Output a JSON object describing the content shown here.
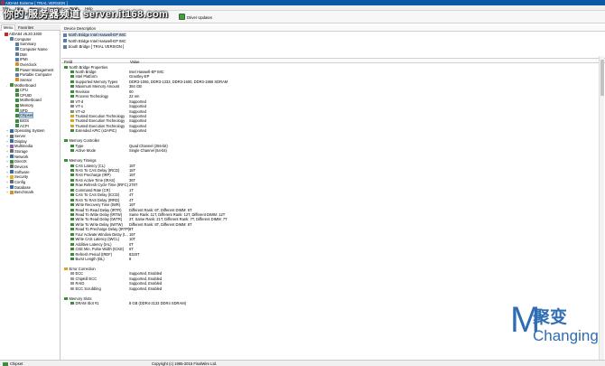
{
  "window": {
    "title": "AIDA64 Extreme [ TRIAL VERSION ]"
  },
  "watermark": "你的·服务器频道 server.it168.com",
  "menu": [
    "File",
    "View",
    "Report",
    "Favorites",
    "Tools",
    "Help"
  ],
  "toolbar": {
    "driver_updates": "Driver Updates"
  },
  "left_tabs": {
    "menu": "Menu",
    "favorites": "Favorites"
  },
  "tree": [
    {
      "label": "AIDA64 v5.20.3400",
      "level": 0,
      "exp": "",
      "color": "#c62828"
    },
    {
      "label": "Computer",
      "level": 1,
      "exp": "-",
      "color": "#5a7fa6"
    },
    {
      "label": "Summary",
      "level": 2,
      "exp": "",
      "color": "#5a7fa6"
    },
    {
      "label": "Computer Name",
      "level": 2,
      "exp": "",
      "color": "#5a7fa6"
    },
    {
      "label": "DMI",
      "level": 2,
      "exp": "",
      "color": "#5a7fa6"
    },
    {
      "label": "IPMI",
      "level": 2,
      "exp": "",
      "color": "#5a7fa6"
    },
    {
      "label": "Overclock",
      "level": 2,
      "exp": "",
      "color": "#e08a1f"
    },
    {
      "label": "Power Management",
      "level": 2,
      "exp": "",
      "color": "#5aa04c"
    },
    {
      "label": "Portable Computer",
      "level": 2,
      "exp": "",
      "color": "#5a7fa6"
    },
    {
      "label": "Sensor",
      "level": 2,
      "exp": "",
      "color": "#e08a1f"
    },
    {
      "label": "Motherboard",
      "level": 1,
      "exp": "-",
      "color": "#3a8f3a"
    },
    {
      "label": "CPU",
      "level": 2,
      "exp": "",
      "color": "#3a8f3a"
    },
    {
      "label": "CPUID",
      "level": 2,
      "exp": "",
      "color": "#3a8f3a"
    },
    {
      "label": "Motherboard",
      "level": 2,
      "exp": "",
      "color": "#3a8f3a"
    },
    {
      "label": "Memory",
      "level": 2,
      "exp": "",
      "color": "#3a8f3a"
    },
    {
      "label": "SPD",
      "level": 2,
      "exp": "",
      "color": "#3a8f3a"
    },
    {
      "label": "Chipset",
      "level": 2,
      "exp": "",
      "color": "#3a8f3a",
      "selected": true
    },
    {
      "label": "BIOS",
      "level": 2,
      "exp": "",
      "color": "#3a8f3a"
    },
    {
      "label": "ACPI",
      "level": 2,
      "exp": "",
      "color": "#3a8f3a"
    },
    {
      "label": "Operating System",
      "level": 1,
      "exp": "+",
      "color": "#2f6db3"
    },
    {
      "label": "Server",
      "level": 1,
      "exp": "+",
      "color": "#6b6b6b"
    },
    {
      "label": "Display",
      "level": 1,
      "exp": "+",
      "color": "#2f6db3"
    },
    {
      "label": "Multimedia",
      "level": 1,
      "exp": "+",
      "color": "#8a5db5"
    },
    {
      "label": "Storage",
      "level": 1,
      "exp": "+",
      "color": "#6b6b6b"
    },
    {
      "label": "Network",
      "level": 1,
      "exp": "+",
      "color": "#2f6db3"
    },
    {
      "label": "DirectX",
      "level": 1,
      "exp": "+",
      "color": "#3a8f3a"
    },
    {
      "label": "Devices",
      "level": 1,
      "exp": "+",
      "color": "#6b6b6b"
    },
    {
      "label": "Software",
      "level": 1,
      "exp": "+",
      "color": "#2f6db3"
    },
    {
      "label": "Security",
      "level": 1,
      "exp": "+",
      "color": "#e0b01f"
    },
    {
      "label": "Config",
      "level": 1,
      "exp": "+",
      "color": "#6b6b6b"
    },
    {
      "label": "Database",
      "level": 1,
      "exp": "+",
      "color": "#2f6db3"
    },
    {
      "label": "Benchmark",
      "level": 1,
      "exp": "+",
      "color": "#e08a1f"
    }
  ],
  "device_header": "Device Description",
  "devices": [
    {
      "label": "North Bridge Intel Haswell-EP IMC",
      "selected": true
    },
    {
      "label": "North Bridge Intel Haswell-EP IMC",
      "selected": false
    },
    {
      "label": "South Bridge [ TRIAL VERSION ]",
      "selected": false
    }
  ],
  "grid_header": {
    "field": "Field",
    "value": "Value"
  },
  "rows": [
    {
      "type": "section",
      "field": "North Bridge Properties",
      "value": "",
      "color": "#3a8f3a"
    },
    {
      "type": "item",
      "field": "North Bridge",
      "value": "Intel Haswell-EP IMC",
      "color": "#3a8f3a"
    },
    {
      "type": "item",
      "field": "Intel Platform",
      "value": "Grantley-EP",
      "color": "#3a8f3a"
    },
    {
      "type": "item",
      "field": "Supported Memory Types",
      "value": "DDR3-1066, DDR3-1333, DDR3-1600, DDR3-1866 SDRAM",
      "color": "#3a8f3a"
    },
    {
      "type": "item",
      "field": "Maximum Memory Amount",
      "value": "384 GB",
      "color": "#3a8f3a"
    },
    {
      "type": "item",
      "field": "Revision",
      "value": "00",
      "color": "#3a8f3a"
    },
    {
      "type": "item",
      "field": "Process Technology",
      "value": "22 nm",
      "color": "#3a8f3a"
    },
    {
      "type": "item",
      "field": "VT-d",
      "value": "Supported",
      "color": "#8a8a8a"
    },
    {
      "type": "item",
      "field": "VT-x",
      "value": "Supported",
      "color": "#8a8a8a"
    },
    {
      "type": "item",
      "field": "VT-x2",
      "value": "Supported",
      "color": "#8a8a8a"
    },
    {
      "type": "item",
      "field": "Trusted Execution Technology",
      "value": "Supported",
      "color": "#e0a020"
    },
    {
      "type": "item",
      "field": "Trusted Execution Technology",
      "value": "Supported",
      "color": "#e0a020"
    },
    {
      "type": "item",
      "field": "Trusted Execution Technology",
      "value": "Supported",
      "color": "#e0a020"
    },
    {
      "type": "item",
      "field": "Extended APIC (x2APIC)",
      "value": "Supported",
      "color": "#3a8f3a"
    },
    {
      "type": "blank"
    },
    {
      "type": "section",
      "field": "Memory Controller",
      "value": "",
      "color": "#3a8f3a"
    },
    {
      "type": "item",
      "field": "Type",
      "value": "Quad Channel (256-bit)",
      "color": "#3a8f3a"
    },
    {
      "type": "item",
      "field": "Active Mode",
      "value": "Single Channel (64-bit)",
      "color": "#3a8f3a"
    },
    {
      "type": "blank"
    },
    {
      "type": "section",
      "field": "Memory Timings",
      "value": "",
      "color": "#3a8f3a"
    },
    {
      "type": "item",
      "field": "CAS Latency (CL)",
      "value": "15T",
      "color": "#3a8f3a"
    },
    {
      "type": "item",
      "field": "RAS To CAS Delay (tRCD)",
      "value": "15T",
      "color": "#3a8f3a"
    },
    {
      "type": "item",
      "field": "RAS Precharge (tRP)",
      "value": "15T",
      "color": "#3a8f3a"
    },
    {
      "type": "item",
      "field": "RAS Active Time (tRAS)",
      "value": "36T",
      "color": "#3a8f3a"
    },
    {
      "type": "item",
      "field": "Row Refresh Cycle Time (tRFC)",
      "value": "278T",
      "color": "#3a8f3a"
    },
    {
      "type": "item",
      "field": "Command Rate (CR)",
      "value": "1T",
      "color": "#3a8f3a"
    },
    {
      "type": "item",
      "field": "CAS To CAS Delay (tCCD)",
      "value": "4T",
      "color": "#3a8f3a"
    },
    {
      "type": "item",
      "field": "RAS To RAS Delay (tRRD)",
      "value": "4T",
      "color": "#3a8f3a"
    },
    {
      "type": "item",
      "field": "Write Recovery Time (tWR)",
      "value": "16T",
      "color": "#3a8f3a"
    },
    {
      "type": "item",
      "field": "Read To Read Delay (tRTR)",
      "value": "Different Rank: 6T, Different DIMM: 6T",
      "color": "#3a8f3a"
    },
    {
      "type": "item",
      "field": "Read To Write Delay (tRTW)",
      "value": "Same Rank: 11T, Different Rank: 12T, Different DIMM: 12T",
      "color": "#3a8f3a"
    },
    {
      "type": "item",
      "field": "Write To Read Delay (tWTR)",
      "value": "3T, Same Rank: 21T, Different Rank: 7T, Different DIMM: 7T",
      "color": "#3a8f3a"
    },
    {
      "type": "item",
      "field": "Write To Write Delay (tWTW)",
      "value": "Different Rank: 8T, Different DIMM: 8T",
      "color": "#3a8f3a"
    },
    {
      "type": "item",
      "field": "Read To Precharge Delay (tRTP)",
      "value": "8T",
      "color": "#3a8f3a"
    },
    {
      "type": "item",
      "field": "Four Activate Window Delay (t...",
      "value": "16T",
      "color": "#3a8f3a"
    },
    {
      "type": "item",
      "field": "Write CAS Latency (tWCL)",
      "value": "10T",
      "color": "#3a8f3a"
    },
    {
      "type": "item",
      "field": "Additive Latency (tAL)",
      "value": "0T",
      "color": "#3a8f3a"
    },
    {
      "type": "item",
      "field": "CKE Min. Pulse Width (tCKE)",
      "value": "6T",
      "color": "#3a8f3a"
    },
    {
      "type": "item",
      "field": "Refresh Period (tREF)",
      "value": "8320T",
      "color": "#3a8f3a"
    },
    {
      "type": "item",
      "field": "Burst Length (BL)",
      "value": "8",
      "color": "#3a8f3a"
    },
    {
      "type": "blank"
    },
    {
      "type": "section",
      "field": "Error Correction",
      "value": "",
      "color": "#e0a020"
    },
    {
      "type": "item",
      "field": "ECC",
      "value": "Supported, Enabled",
      "color": "#9e9e9e"
    },
    {
      "type": "item",
      "field": "ChipKill ECC",
      "value": "Supported, Enabled",
      "color": "#9e9e9e"
    },
    {
      "type": "item",
      "field": "RAID",
      "value": "Supported, Enabled",
      "color": "#9e9e9e"
    },
    {
      "type": "item",
      "field": "ECC Scrubbing",
      "value": "Supported, Enabled",
      "color": "#9e9e9e"
    },
    {
      "type": "blank"
    },
    {
      "type": "section",
      "field": "Memory Slots",
      "value": "",
      "color": "#3a8f3a"
    },
    {
      "type": "item",
      "field": "DRAM Slot #1",
      "value": "8 GB  (DDR4-2133 DDR4 SDRAM)",
      "color": "#3a8f3a"
    }
  ],
  "status": {
    "left": "Chipset",
    "copyright": "Copyright (c) 1995-2015 FinalWire Ltd."
  },
  "logo": {
    "letter": "M",
    "zh": "聚变",
    "en": "Changing"
  }
}
